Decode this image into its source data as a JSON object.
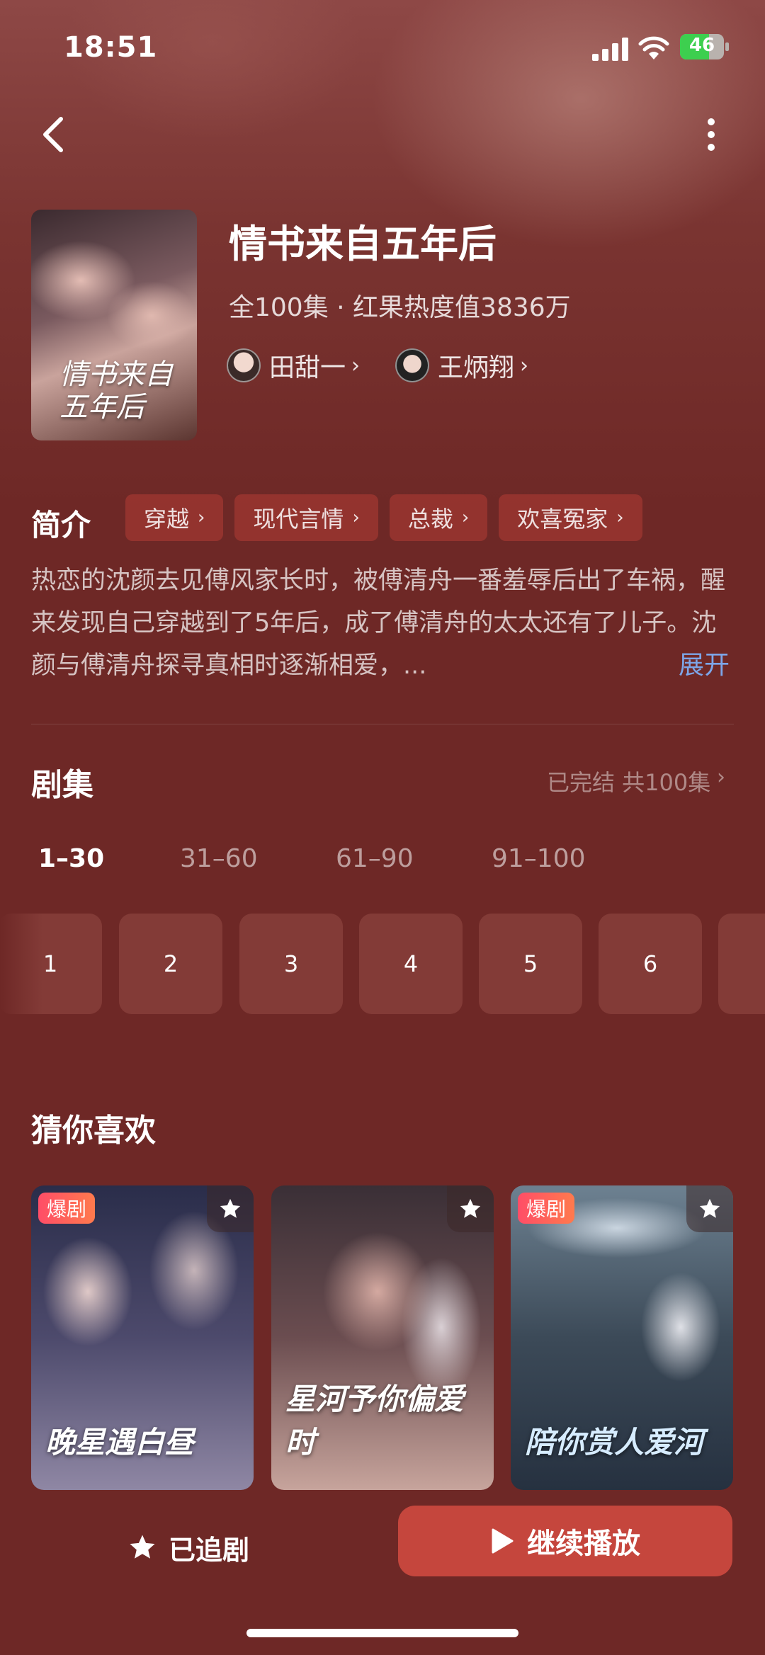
{
  "status_bar": {
    "time": "18:51",
    "battery": "46"
  },
  "show": {
    "title": "情书来自五年后",
    "meta": "全100集 · 红果热度值3836万",
    "poster_title": "情书来自\n五年后",
    "cast": [
      {
        "name": "田甜一"
      },
      {
        "name": "王炳翔"
      }
    ]
  },
  "intro": {
    "label": "简介",
    "tags": [
      "穿越",
      "现代言情",
      "总裁",
      "欢喜冤家"
    ],
    "synopsis": "热恋的沈颜去见傅风家长时，被傅清舟一番羞辱后出了车祸，醒来发现自己穿越到了5年后，成了傅清舟的太太还有了儿子。沈颜与傅清舟探寻真相时逐渐相爱，...",
    "expand": "展开"
  },
  "episodes": {
    "label": "剧集",
    "status": "已完结 共100集",
    "ranges": [
      "1–30",
      "31–60",
      "61–90",
      "91–100"
    ],
    "active_range": 0,
    "items": [
      "1",
      "2",
      "3",
      "4",
      "5",
      "6"
    ]
  },
  "recommend": {
    "label": "猜你喜欢",
    "cards": [
      {
        "title": "晚星遇白昼",
        "badge": "爆剧"
      },
      {
        "title": "星河予你偏爱时",
        "badge": ""
      },
      {
        "title": "陪你赏人爱河",
        "badge": "爆剧"
      }
    ]
  },
  "actions": {
    "follow": "已追剧",
    "play": "继续播放"
  },
  "colors": {
    "background": "#6e2826",
    "play_button": "#c5463d",
    "link": "#7da6e8",
    "tag": "#a03732"
  }
}
